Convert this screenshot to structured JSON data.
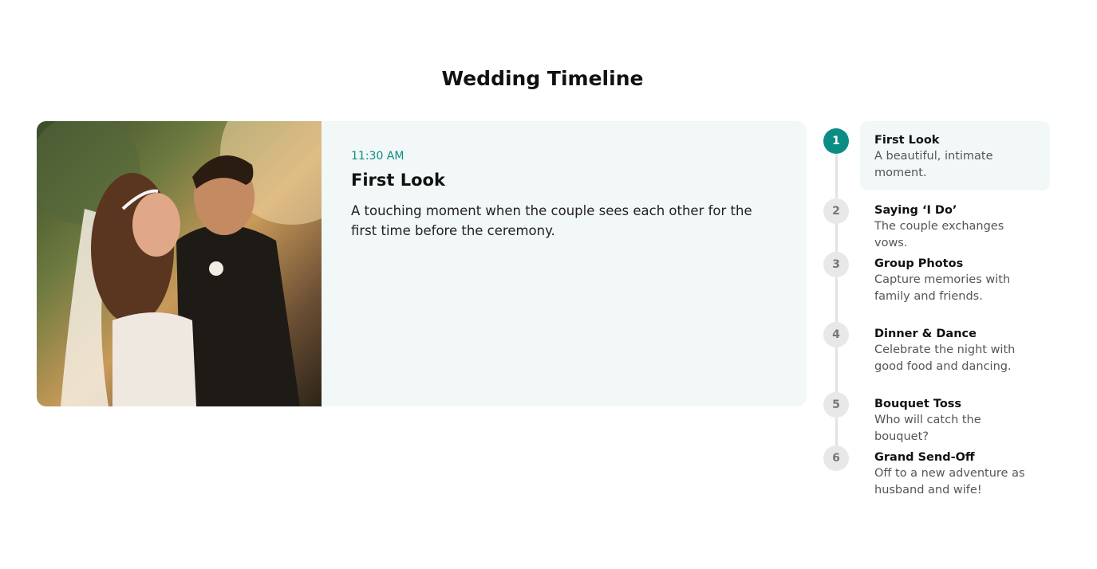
{
  "page": {
    "title": "Wedding Timeline"
  },
  "feature": {
    "time": "11:30 AM",
    "title": "First Look",
    "description": "A touching moment when the couple sees each other for the first time before the ceremony."
  },
  "steps": [
    {
      "number": "1",
      "title": "First Look",
      "description": "A beautiful, intimate moment.",
      "active": true
    },
    {
      "number": "2",
      "title": "Saying ‘I Do’",
      "description": "The couple exchanges vows.",
      "active": false
    },
    {
      "number": "3",
      "title": "Group Photos",
      "description": "Capture memories with family and friends.",
      "active": false
    },
    {
      "number": "4",
      "title": "Dinner & Dance",
      "description": "Celebrate the night with good food and dancing.",
      "active": false
    },
    {
      "number": "5",
      "title": "Bouquet Toss",
      "description": "Who will catch the bouquet?",
      "active": false
    },
    {
      "number": "6",
      "title": "Grand Send-Off",
      "description": "Off to a new adventure as husband and wife!",
      "active": false
    }
  ],
  "colors": {
    "accent": "#0b8d86",
    "card_bg": "#f2f8f7",
    "inactive_circle": "#e8e8e8"
  }
}
